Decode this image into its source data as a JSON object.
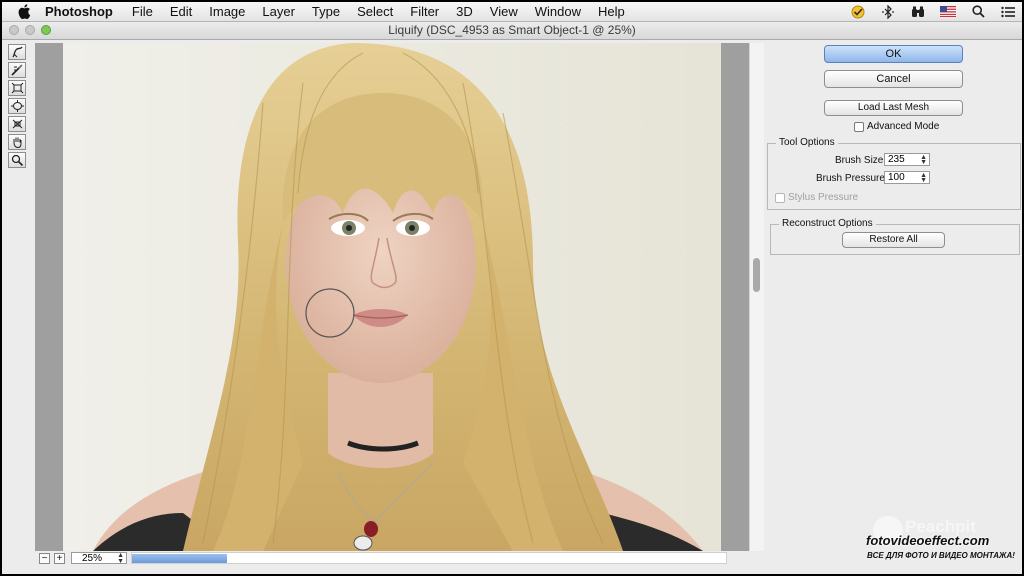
{
  "menubar": {
    "app": "Photoshop",
    "items": [
      "File",
      "Edit",
      "Image",
      "Layer",
      "Type",
      "Select",
      "Filter",
      "3D",
      "View",
      "Window",
      "Help"
    ],
    "status_icons": [
      "norton-check-icon",
      "bluetooth-icon",
      "binoculars-icon",
      "us-flag-icon",
      "spotlight-search-icon",
      "notification-list-icon"
    ]
  },
  "window": {
    "title": "Liquify (DSC_4953 as Smart Object-1 @ 25%)"
  },
  "tools": [
    "forward-warp-tool-icon",
    "reconstruct-tool-icon",
    "pucker-tool-icon",
    "bloat-tool-icon",
    "push-left-tool-icon",
    "hand-tool-icon",
    "zoom-tool-icon"
  ],
  "canvas": {
    "zoom": "25%",
    "zoom_out": "−",
    "zoom_in": "+",
    "brush_cursor": "brush-circle-icon"
  },
  "panel": {
    "ok": "OK",
    "cancel": "Cancel",
    "load_last_mesh": "Load Last Mesh",
    "advanced_mode": "Advanced Mode",
    "tool_options": {
      "title": "Tool Options",
      "brush_size_label": "Brush Size:",
      "brush_size": "235",
      "brush_pressure_label": "Brush Pressure:",
      "brush_pressure": "100",
      "stylus_pressure": "Stylus Pressure"
    },
    "reconstruct": {
      "title": "Reconstruct Options",
      "restore_all": "Restore All"
    }
  },
  "watermark": {
    "brand": "Peachpit",
    "site": "fotovideoeffect.com",
    "tagline": "ВСЕ ДЛЯ ФОТО И ВИДЕО МОНТАЖА!"
  },
  "colors": {
    "default_button": "#8fb7ea",
    "hair": "#d9be7f",
    "background_wall": "#e8e6dc"
  }
}
